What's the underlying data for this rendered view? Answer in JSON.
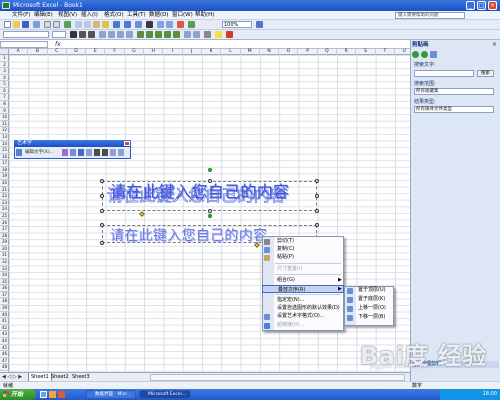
{
  "window": {
    "title": "Microsoft Excel - Book1",
    "controls": [
      "_",
      "□",
      "×"
    ]
  },
  "menubar": {
    "items": [
      "文件(F)",
      "编辑(E)",
      "视图(V)",
      "插入(I)",
      "格式(O)",
      "工具(T)",
      "数据(D)",
      "窗口(W)",
      "帮助(H)"
    ],
    "help_placeholder": "键入需要帮助的问题"
  },
  "toolbar": {
    "zoom": "100%"
  },
  "sheet": {
    "columns": [
      "A",
      "B",
      "C",
      "D",
      "E",
      "F",
      "G",
      "H",
      "I",
      "J",
      "K",
      "L",
      "M",
      "N",
      "O",
      "P",
      "Q",
      "R",
      "S",
      "T",
      "U"
    ],
    "rows": [
      "1",
      "2",
      "3",
      "4",
      "5",
      "6",
      "7",
      "8",
      "9",
      "10",
      "11",
      "12",
      "13",
      "14",
      "15",
      "16",
      "17",
      "18",
      "19",
      "20",
      "21",
      "22",
      "23",
      "24",
      "25",
      "26",
      "27",
      "28",
      "29",
      "30",
      "31",
      "32",
      "33",
      "34",
      "35",
      "36",
      "37",
      "38",
      "39",
      "40",
      "41",
      "42",
      "43",
      "44",
      "45",
      "46",
      "47",
      "48"
    ],
    "tabs": [
      "Sheet1",
      "Sheet2",
      "Sheet3"
    ]
  },
  "wordart_toolbar": {
    "title": "艺术字",
    "edit_label": "编辑文字(X)..."
  },
  "wordart": {
    "text_top": "请在此键入您自己的内容",
    "text_bottom": "请在此键入您自己的内容"
  },
  "context_menu": {
    "items": [
      {
        "label": "剪切(T)",
        "disabled": false
      },
      {
        "label": "复制(C)",
        "disabled": false
      },
      {
        "label": "粘贴(P)",
        "disabled": false
      },
      {
        "label": "尺寸重置(I)",
        "disabled": true
      },
      {
        "label": "组合(G)",
        "disabled": false,
        "submenu": true
      },
      {
        "label": "叠放次序(R)",
        "disabled": false,
        "submenu": true,
        "highlighted": true
      },
      {
        "label": "指定宏(N)...",
        "disabled": false
      },
      {
        "label": "设置自选图形的默认效果(D)",
        "disabled": false
      },
      {
        "label": "设置艺术字格式(O)...",
        "disabled": false
      },
      {
        "label": "超链接(H)...",
        "disabled": true
      }
    ]
  },
  "submenu": {
    "items": [
      "置于顶层(U)",
      "置于底层(K)",
      "上移一层(O)",
      "下移一层(B)"
    ]
  },
  "taskpane": {
    "title": "剪贴画",
    "search_label": "搜索文字:",
    "search_button": "搜索",
    "range_label": "搜索范围:",
    "range_value": "所有收藏集",
    "type_label": "结果类型:",
    "type_value": "所有媒体文件类型",
    "footer_link": "管理剪辑"
  },
  "statusbar": {
    "left": "就绪",
    "right": "数字"
  },
  "taskbar": {
    "start": "开始",
    "items": [
      "数据界面 - Micr...",
      "Microsoft Excel..."
    ],
    "clock": "18:00"
  },
  "watermark": {
    "main": "Bai度 经验",
    "sub": "jingyan.baidu.com"
  }
}
